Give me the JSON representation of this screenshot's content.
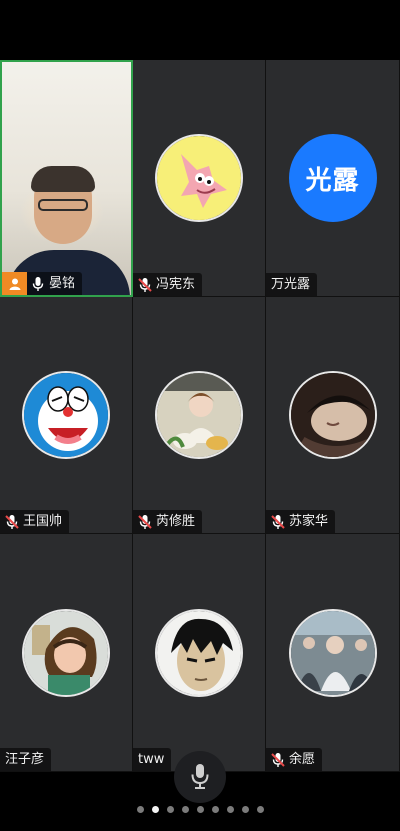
{
  "meeting": {
    "layout": "video-grid",
    "pages": {
      "active_index": 1,
      "dot_count": 9
    },
    "participants": [
      {
        "name": "晏铭",
        "mic": "on",
        "video": true,
        "host": true,
        "active": true,
        "avatar": "live-video"
      },
      {
        "name": "冯宪东",
        "mic": "muted",
        "video": false,
        "host": false,
        "avatar": "patrick-star"
      },
      {
        "name": "万光露",
        "mic": "none",
        "video": false,
        "host": false,
        "avatar_text": "光露"
      },
      {
        "name": "王国帅",
        "mic": "muted",
        "video": false,
        "host": false,
        "avatar": "doraemon"
      },
      {
        "name": "芮修胜",
        "mic": "muted",
        "video": false,
        "host": false,
        "avatar": "girl-with-ducks"
      },
      {
        "name": "苏家华",
        "mic": "muted",
        "video": false,
        "host": false,
        "avatar": "sleeping-person"
      },
      {
        "name": "汪子彦",
        "mic": "none",
        "video": false,
        "host": false,
        "avatar": "anime-girl"
      },
      {
        "name": "tww",
        "mic": "none",
        "video": false,
        "host": false,
        "avatar": "anime-boy"
      },
      {
        "name": "余愿",
        "mic": "muted",
        "video": false,
        "host": false,
        "avatar": "street-photo"
      }
    ]
  },
  "controls": {
    "center_mic_icon": "microphone-icon"
  },
  "colors": {
    "background": "#000000",
    "tile": "#2b2c2e",
    "active_border": "#31a24c",
    "host_badge": "#f08a24",
    "avatar_blue": "#1a7aff",
    "muted_red": "#e84a4a"
  }
}
